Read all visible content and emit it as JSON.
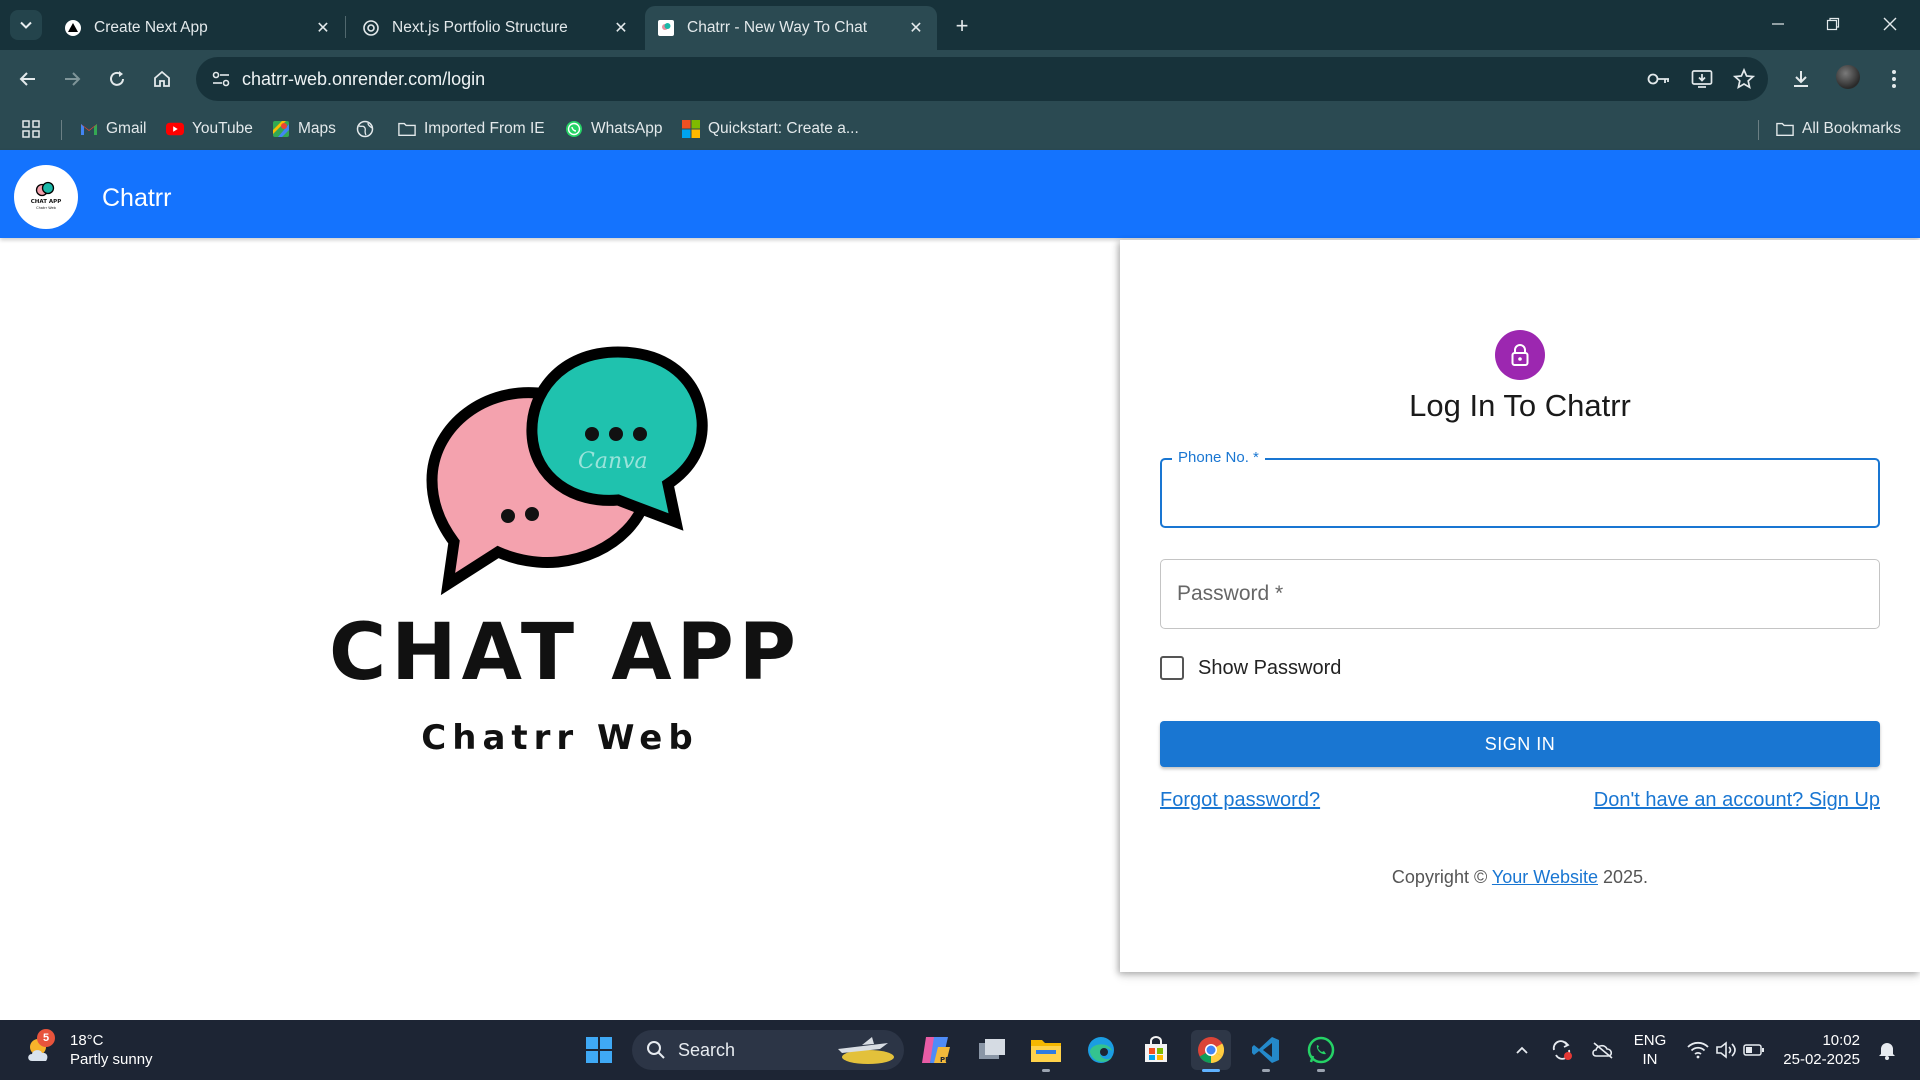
{
  "browser": {
    "tabs": [
      {
        "title": "Create Next App",
        "active": false
      },
      {
        "title": "Next.js Portfolio Structure",
        "active": false
      },
      {
        "title": "Chatrr - New Way To Chat",
        "active": true
      }
    ],
    "url": "chatrr-web.onrender.com/login",
    "bookmarks": [
      {
        "label": "Gmail",
        "icon": "gmail-icon"
      },
      {
        "label": "YouTube",
        "icon": "youtube-icon"
      },
      {
        "label": "Maps",
        "icon": "maps-icon"
      },
      {
        "label": "",
        "icon": "globe-icon"
      },
      {
        "label": "Imported From IE",
        "icon": "folder-icon"
      },
      {
        "label": "WhatsApp",
        "icon": "whatsapp-icon"
      },
      {
        "label": "Quickstart: Create a...",
        "icon": "microsoft-icon"
      }
    ],
    "all_bookmarks": "All Bookmarks"
  },
  "app": {
    "name": "Chatrr",
    "brand_color": "#1473fe",
    "hero": {
      "title": "CHAT APP",
      "subtitle": "Chatrr Web",
      "watermark": "Canva",
      "logo_small_title": "CHAT APP",
      "logo_small_sub": "Chatrr Web"
    },
    "login": {
      "title": "Log In To Chatrr",
      "phone_label": "Phone No. *",
      "phone_value": "",
      "password_label": "Password *",
      "show_password_label": "Show Password",
      "show_password_checked": false,
      "signin_button": "SIGN IN",
      "forgot_link": "Forgot password?",
      "signup_link": "Don't have an account? Sign Up",
      "copyright_prefix": "Copyright ©",
      "copyright_link": "Your Website",
      "copyright_suffix": "2025.",
      "accent_color": "#1976d2",
      "avatar_color": "#9c27b0"
    }
  },
  "taskbar": {
    "weather": {
      "temp": "18°C",
      "condition": "Partly sunny",
      "badge": "5"
    },
    "search_label": "Search",
    "language": "ENG",
    "region": "IN",
    "time": "10:02",
    "date": "25-02-2025"
  }
}
